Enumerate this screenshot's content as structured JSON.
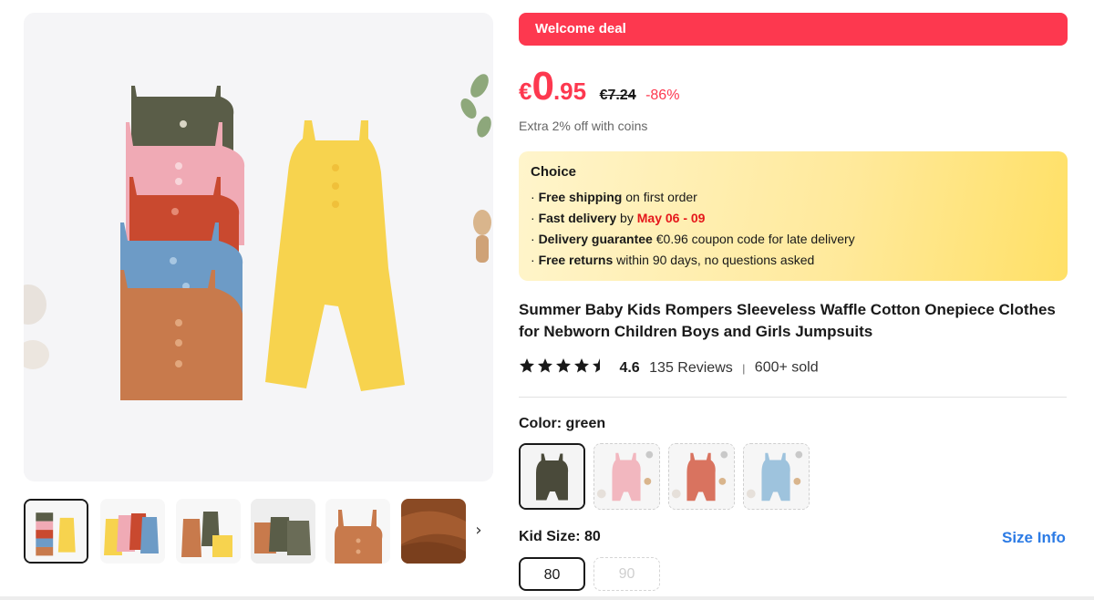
{
  "banner": {
    "label": "Welcome deal",
    "color": "#fd384f"
  },
  "price": {
    "currency": "€",
    "integer": "0",
    "decimal": ".95",
    "original": "€7.24",
    "discount": "-86%",
    "coins_note": "Extra 2% off with coins"
  },
  "choice": {
    "title": "Choice",
    "lines": [
      {
        "bullet": "·",
        "bold": "Free shipping",
        "text": " on first order"
      },
      {
        "bullet": "·",
        "bold": "Fast delivery",
        "text": " by ",
        "highlight": "May 06 - 09"
      },
      {
        "bullet": "·",
        "bold": "Delivery guarantee",
        "text": "  €0.96 coupon code for late delivery"
      },
      {
        "bullet": "·",
        "bold": "Free returns",
        "text": "  within 90 days, no questions asked"
      }
    ]
  },
  "product": {
    "title": "Summer Baby Kids Rompers Sleeveless Waffle Cotton Onepiece Clothes for Nebworn Children Boys and Girls Jumpsuits",
    "rating": "4.6",
    "rating_value": 4.6,
    "reviews": "135 Reviews",
    "separator": "|",
    "sold": "600+ sold"
  },
  "color": {
    "label": "Color: green",
    "swatches": [
      {
        "name": "green",
        "hex": "#5a5a45",
        "selected": true
      },
      {
        "name": "pink",
        "hex": "#f2b7bf",
        "selected": false
      },
      {
        "name": "red",
        "hex": "#d9735f",
        "selected": false
      },
      {
        "name": "blue",
        "hex": "#9ec3dd",
        "selected": false
      }
    ]
  },
  "size": {
    "label": "Kid Size: 80",
    "info_link": "Size Info",
    "options": [
      {
        "label": "80",
        "selected": true,
        "available": true
      },
      {
        "label": "90",
        "selected": false,
        "available": false
      }
    ]
  },
  "gallery": {
    "next_arrow": "›",
    "thumbnails": [
      "mix-stack",
      "mix-flat",
      "orange-set",
      "dark-set",
      "orange-single",
      "fabric-closeup"
    ]
  },
  "colors": {
    "accent": "#fd384f",
    "link": "#2c7be5",
    "highlight_red": "#e5171b"
  }
}
